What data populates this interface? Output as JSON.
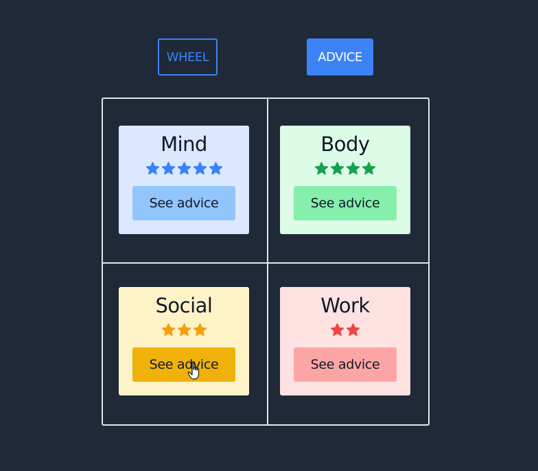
{
  "tabs": {
    "wheel_label": "WHEEL",
    "advice_label": "ADVICE",
    "active": "ADVICE"
  },
  "colors": {
    "background": "#1f2937",
    "accent": "#3b82f6",
    "grid_line": "#e5e7eb"
  },
  "cards": [
    {
      "title": "Mind",
      "rating": 5,
      "button_label": "See advice",
      "card_bg": "#dbe8fe",
      "star_color": "#3b82f6",
      "button_bg": "#93c5fd",
      "star_icon": "star-icon"
    },
    {
      "title": "Body",
      "rating": 4,
      "button_label": "See advice",
      "card_bg": "#dcfce7",
      "star_color": "#16a34a",
      "button_bg": "#86efac",
      "star_icon": "star-icon"
    },
    {
      "title": "Social",
      "rating": 3,
      "button_label": "See advice",
      "card_bg": "#fef3c7",
      "star_color": "#f59e0b",
      "button_bg": "#f0b20a",
      "star_icon": "star-icon"
    },
    {
      "title": "Work",
      "rating": 2,
      "button_label": "See advice",
      "card_bg": "#fee2e2",
      "star_color": "#ef4444",
      "button_bg": "#fca5a5",
      "star_icon": "star-icon"
    }
  ],
  "cursor": {
    "icon": "hand-pointer-icon"
  }
}
